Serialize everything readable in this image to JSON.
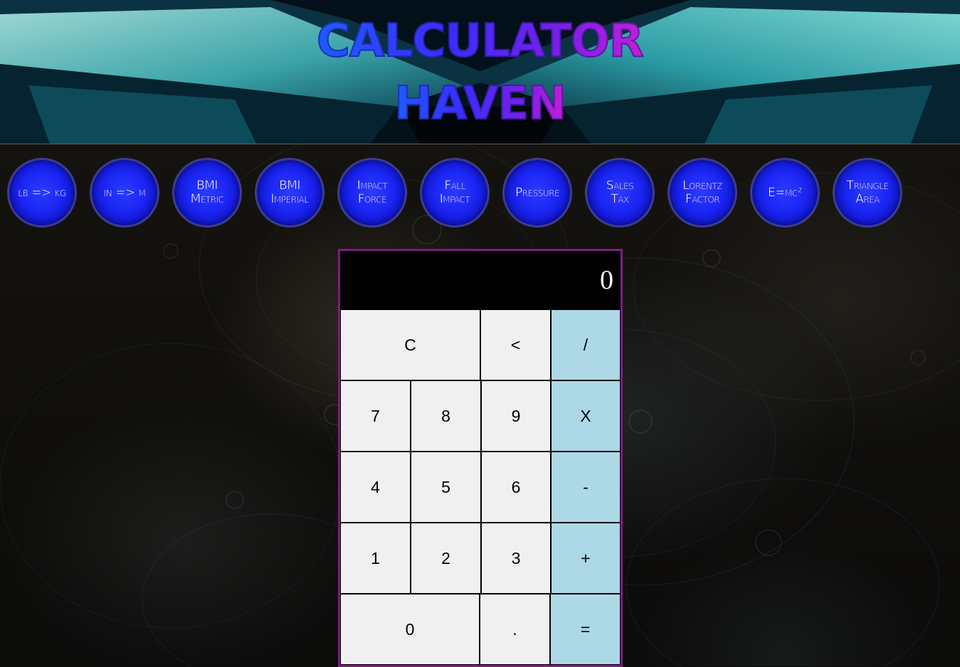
{
  "header": {
    "title_line1": "Calculator",
    "title_line2": "Haven"
  },
  "nav": {
    "items": [
      {
        "label": "lb => kg",
        "name": "nav-lb-kg"
      },
      {
        "label": "in => m",
        "name": "nav-in-m"
      },
      {
        "label": "BMI\nMetric",
        "name": "nav-bmi-metric"
      },
      {
        "label": "BMI\nImperial",
        "name": "nav-bmi-imperial"
      },
      {
        "label": "Impact\nForce",
        "name": "nav-impact-force"
      },
      {
        "label": "Fall\nImpact",
        "name": "nav-fall-impact"
      },
      {
        "label": "Pressure",
        "name": "nav-pressure"
      },
      {
        "label": "Sales\nTax",
        "name": "nav-sales-tax"
      },
      {
        "label": "Lorentz\nFactor",
        "name": "nav-lorentz-factor"
      },
      {
        "label": "E=mc²",
        "name": "nav-emc2"
      },
      {
        "label": "Triangle\nArea",
        "name": "nav-triangle-area"
      }
    ]
  },
  "calculator": {
    "display": "0",
    "keys": {
      "clear": "C",
      "back": "<",
      "divide": "/",
      "seven": "7",
      "eight": "8",
      "nine": "9",
      "multiply": "X",
      "four": "4",
      "five": "5",
      "six": "6",
      "minus": "-",
      "one": "1",
      "two": "2",
      "three": "3",
      "plus": "+",
      "zero": "0",
      "decimal": ".",
      "equals": "="
    }
  },
  "colors": {
    "nav_button": "#1a25f2",
    "nav_border": "#3d3d8c",
    "calc_border": "#7d1e82",
    "key_bg": "#f0f0f0",
    "operator_bg": "#add8e6",
    "display_bg": "#000000"
  }
}
